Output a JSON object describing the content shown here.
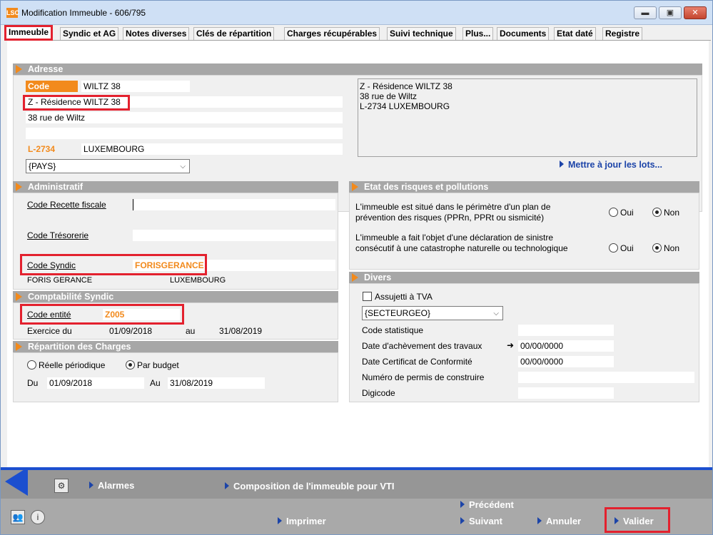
{
  "window": {
    "app_icon": "LSC",
    "title": "Modification Immeuble - 606/795",
    "min_label": "▬",
    "max_label": "▣",
    "close_label": "✕"
  },
  "tabs": [
    {
      "label": "Immeuble"
    },
    {
      "label": "Syndic et AG"
    },
    {
      "label": "Notes diverses"
    },
    {
      "label": "Clés de répartition"
    },
    {
      "label": "Charges récupérables"
    },
    {
      "label": "Suivi technique"
    },
    {
      "label": "Plus..."
    },
    {
      "label": "Documents"
    },
    {
      "label": "Etat daté"
    },
    {
      "label": "Registre"
    }
  ],
  "adresse": {
    "header": "Adresse",
    "code_label": "Code",
    "code_value": "WILTZ 38",
    "line1": "Z - Résidence WILTZ 38",
    "line2": "38 rue de Wiltz",
    "line3": "",
    "postal_code": "L-2734",
    "city": "LUXEMBOURG",
    "country_select": "{PAYS}",
    "preview": [
      "Z - Résidence WILTZ 38",
      "38 rue de Wiltz",
      "L-2734 LUXEMBOURG"
    ],
    "update_link": "Mettre à jour les lots..."
  },
  "administratif": {
    "header": "Administratif",
    "recette_label": "Code Recette fiscale",
    "tresorerie_label": "Code Trésorerie",
    "syndic_label": "Code Syndic",
    "syndic_value": "FORISGERANCE",
    "syndic_name": "FORIS GERANCE",
    "syndic_city": "LUXEMBOURG"
  },
  "comptabilite": {
    "header": "Comptabilité Syndic",
    "entite_label": "Code entité",
    "entite_value": "Z005",
    "exercice_label": "Exercice du",
    "exercice_from": "01/09/2018",
    "au_label": "au",
    "exercice_to": "31/08/2019"
  },
  "repartition": {
    "header": "Répartition des Charges",
    "option1": "Réelle périodique",
    "option2": "Par budget",
    "du_label": "Du",
    "du_value": "01/09/2018",
    "au_label": "Au",
    "au_value": "31/08/2019"
  },
  "risques": {
    "header": "Etat des risques et pollutions",
    "q1": [
      "L'immeuble est situé dans le périmètre d'un plan de",
      "prévention des risques (PPRn, PPRt ou sismicité)"
    ],
    "q2": [
      "L'immeuble a fait l'objet d'une déclaration de sinistre",
      "consécutif à une catastrophe naturelle ou technologique"
    ],
    "oui": "Oui",
    "non": "Non"
  },
  "divers": {
    "header": "Divers",
    "tva_label": "Assujetti à TVA",
    "secteur_select": "{SECTEURGEO}",
    "stat_label": "Code statistique",
    "achevement_label": "Date d'achèvement des travaux",
    "achevement_value": "00/00/0000",
    "certificat_label": "Date Certificat de Conformité",
    "certificat_value": "00/00/0000",
    "permis_label": "Numéro de permis de construire",
    "digicode_label": "Digicode"
  },
  "footer": {
    "alarmes": "Alarmes",
    "composition": "Composition de l'immeuble pour VTI",
    "precedent": "Précédent",
    "suivant": "Suivant",
    "imprimer": "Imprimer",
    "annuler": "Annuler",
    "valider": "Valider"
  },
  "colors": {
    "accent": "#f28a1c",
    "highlight": "#e3212e",
    "link": "#1c44a8",
    "header_grey": "#a7a7a7"
  }
}
